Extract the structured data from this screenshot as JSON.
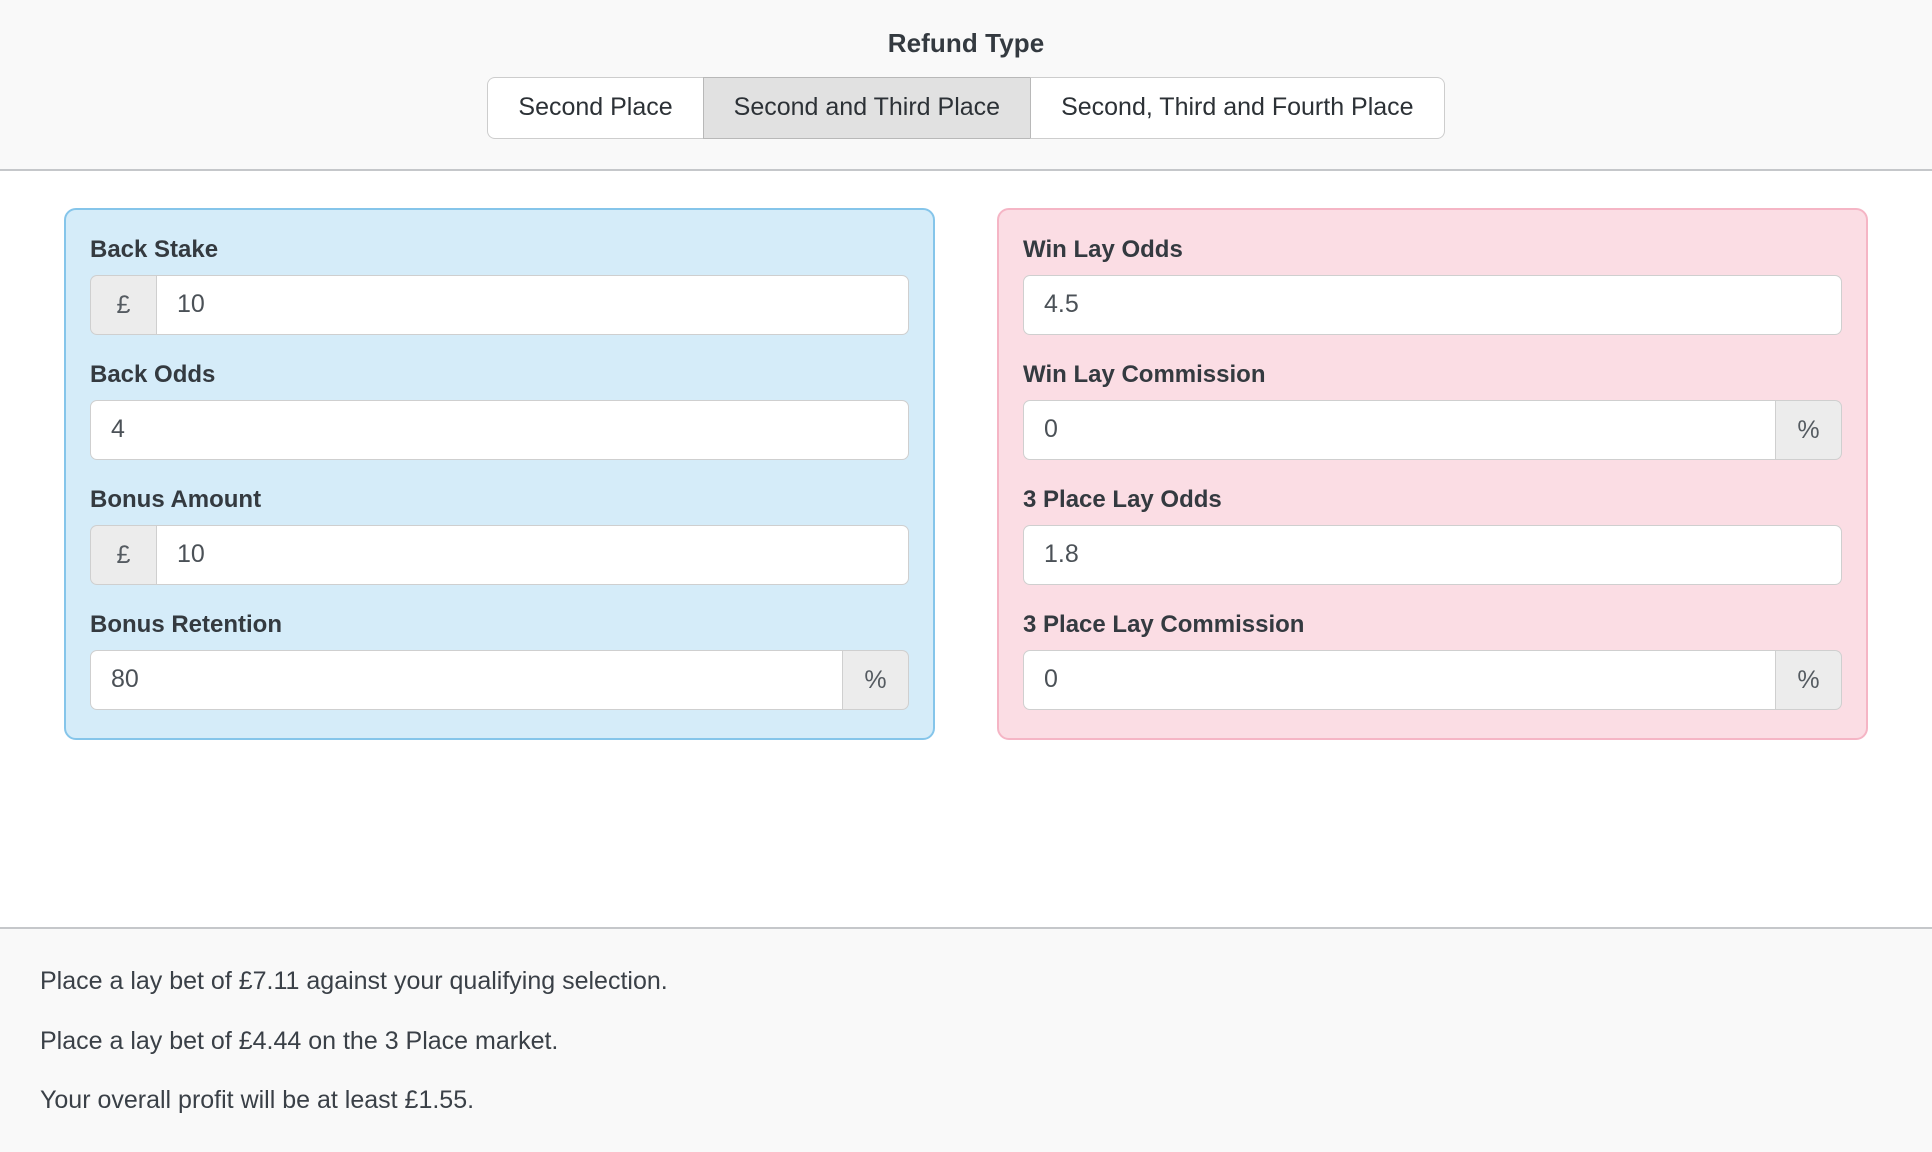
{
  "header": {
    "title": "Refund Type",
    "options": [
      {
        "label": "Second Place",
        "selected": false
      },
      {
        "label": "Second and Third Place",
        "selected": true
      },
      {
        "label": "Second, Third and Fourth Place",
        "selected": false
      }
    ]
  },
  "back_panel": {
    "accent_color": "#85c5ea",
    "background_color": "#d5ecf9",
    "fields": [
      {
        "label": "Back Stake",
        "prefix": "£",
        "suffix": "",
        "value": "10"
      },
      {
        "label": "Back Odds",
        "prefix": "",
        "suffix": "",
        "value": "4"
      },
      {
        "label": "Bonus Amount",
        "prefix": "£",
        "suffix": "",
        "value": "10"
      },
      {
        "label": "Bonus Retention",
        "prefix": "",
        "suffix": "%",
        "value": "80"
      }
    ]
  },
  "lay_panel": {
    "accent_color": "#f5b5c5",
    "background_color": "#fbdde4",
    "fields": [
      {
        "label": "Win Lay Odds",
        "prefix": "",
        "suffix": "",
        "value": "4.5"
      },
      {
        "label": "Win Lay Commission",
        "prefix": "",
        "suffix": "%",
        "value": "0"
      },
      {
        "label": "3 Place Lay Odds",
        "prefix": "",
        "suffix": "",
        "value": "1.8"
      },
      {
        "label": "3 Place Lay Commission",
        "prefix": "",
        "suffix": "%",
        "value": "0"
      }
    ]
  },
  "results": {
    "lines": [
      "Place a lay bet of £7.11 against your qualifying selection.",
      "Place a lay bet of £4.44 on the 3 Place market.",
      "Your overall profit will be at least £1.55."
    ]
  }
}
